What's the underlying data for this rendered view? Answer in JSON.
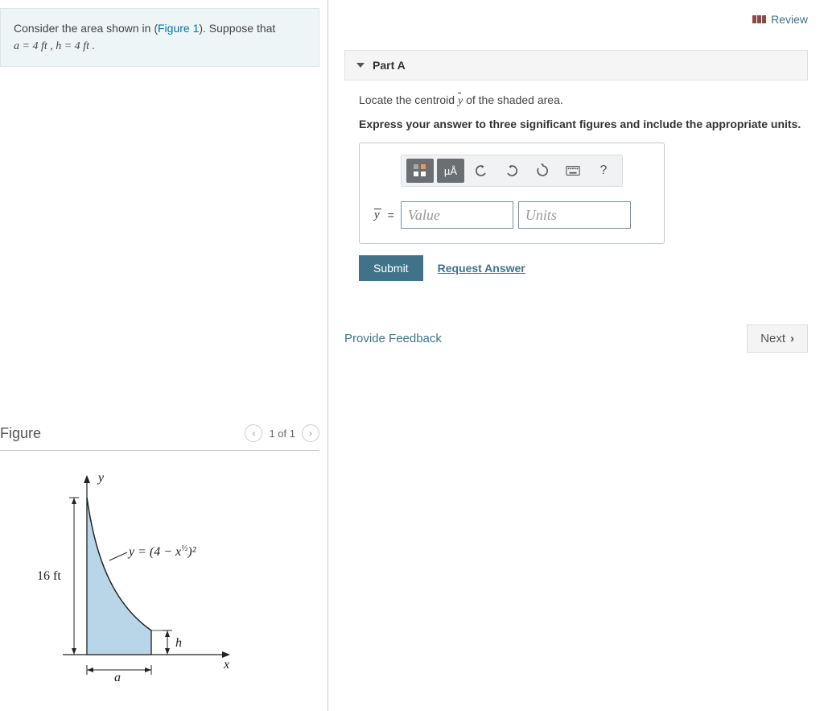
{
  "review": {
    "label": "Review"
  },
  "problem": {
    "pre": "Consider the area shown in (",
    "fig_link": "Figure 1",
    "post": "). Suppose that ",
    "vars": "a = 4  ft , h = 4  ft ."
  },
  "figure": {
    "title": "Figure",
    "pager": "1 of 1",
    "y_label": "y",
    "x_label": "x",
    "height_label": "16 ft",
    "a_label": "a",
    "h_label": "h",
    "curve_label_pre": "y = (4 − x",
    "curve_label_exp": "½",
    "curve_label_post": ")²"
  },
  "part": {
    "title": "Part A",
    "prompt_pre": "Locate the centroid ",
    "prompt_var": "y",
    "prompt_post": " of the shaded area.",
    "instr": "Express your answer to three significant figures and include the appropriate units.",
    "toolbar": {
      "units_symbol": "µÅ",
      "help": "?"
    },
    "answer": {
      "label_var": "y",
      "eq": "=",
      "value_placeholder": "Value",
      "units_placeholder": "Units"
    },
    "submit": "Submit",
    "request": "Request Answer"
  },
  "footer": {
    "feedback": "Provide Feedback",
    "next": "Next"
  }
}
